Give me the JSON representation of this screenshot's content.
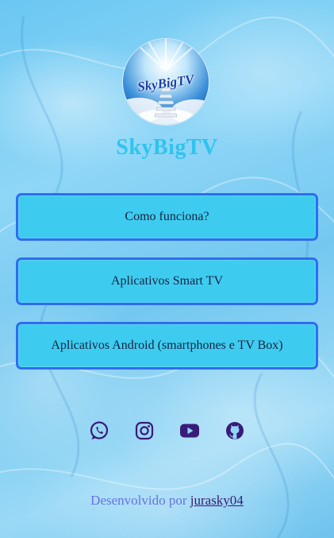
{
  "brand": {
    "logo_text": "SkyBigTV",
    "title": "SkyBigTV"
  },
  "links": [
    {
      "label": "Como funciona?"
    },
    {
      "label": "Aplicativos Smart TV"
    },
    {
      "label": "Aplicativos Android (smartphones e TV Box)"
    }
  ],
  "socials": [
    {
      "icon": "whatsapp-icon"
    },
    {
      "icon": "instagram-icon"
    },
    {
      "icon": "youtube-icon"
    },
    {
      "icon": "github-icon"
    }
  ],
  "footer": {
    "prefix": "Desenvolvido por",
    "author_link": "jurasky04"
  },
  "colors": {
    "title": "#2ec4ee",
    "button_fill": "#3dccf0",
    "button_border": "#2f6cf0",
    "icon": "#3a1a78",
    "footer_text": "#6a72e0"
  }
}
